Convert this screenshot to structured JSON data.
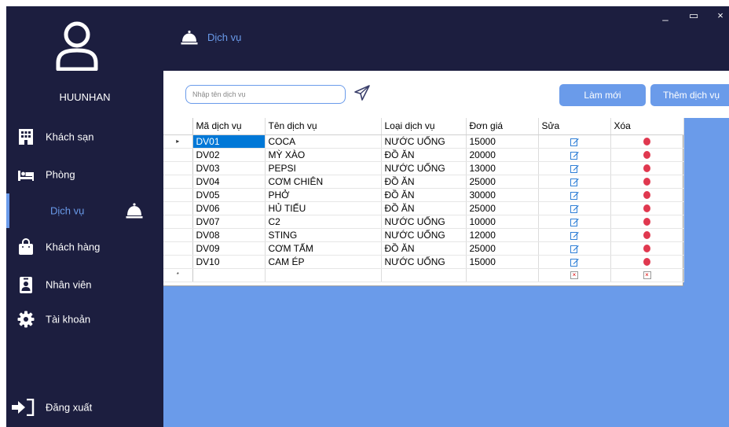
{
  "user": {
    "name": "HUUNHAN"
  },
  "nav": {
    "items": [
      {
        "label": "Khách sạn",
        "icon": "hotel-icon"
      },
      {
        "label": "Phòng",
        "icon": "bed-icon"
      },
      {
        "label": "Dịch vụ",
        "icon": "bell-icon",
        "active": true
      },
      {
        "label": "Khách hàng",
        "icon": "bag-icon"
      },
      {
        "label": "Nhân viên",
        "icon": "id-badge-icon"
      },
      {
        "label": "Tài khoản",
        "icon": "gear-icon"
      }
    ],
    "logout": "Đăng xuất"
  },
  "header": {
    "title": "Dịch vụ",
    "minimize": "_",
    "maximize": "▭",
    "close": "×"
  },
  "toolbar": {
    "search_placeholder": "Nhập tên dịch vụ",
    "search_value": "",
    "refresh_label": "Làm mới",
    "add_label": "Thêm dịch vụ"
  },
  "grid": {
    "columns": [
      "Mã dịch vụ",
      "Tên dịch vụ",
      "Loại dịch vụ",
      "Đơn giá",
      "Sửa",
      "Xóa"
    ],
    "rows": [
      [
        "DV01",
        "COCA",
        "NƯỚC UỐNG",
        "15000"
      ],
      [
        "DV02",
        "MỲ XÀO",
        "ĐỒ ĂN",
        "20000"
      ],
      [
        "DV03",
        "PEPSI",
        "NƯỚC UỐNG",
        "13000"
      ],
      [
        "DV04",
        "CƠM CHIÊN",
        "ĐỒ ĂN",
        "25000"
      ],
      [
        "DV05",
        "PHỞ",
        "ĐỒ ĂN",
        "30000"
      ],
      [
        "DV06",
        "HỦ TIẾU",
        "ĐỒ ĂN",
        "25000"
      ],
      [
        "DV07",
        "C2",
        "NƯỚC UỐNG",
        "10000"
      ],
      [
        "DV08",
        "STING",
        "NƯỚC UỐNG",
        "12000"
      ],
      [
        "DV09",
        "CƠM TẤM",
        "ĐỒ ĂN",
        "25000"
      ],
      [
        "DV10",
        "CAM ÉP",
        "NƯỚC UỐNG",
        "15000"
      ]
    ],
    "current_row_marker": "▸",
    "new_row_marker": "*"
  },
  "colors": {
    "sidebar": "#1c1e3f",
    "accent": "#6a9bea",
    "selection": "#0078d7",
    "delete": "#e0384f"
  }
}
